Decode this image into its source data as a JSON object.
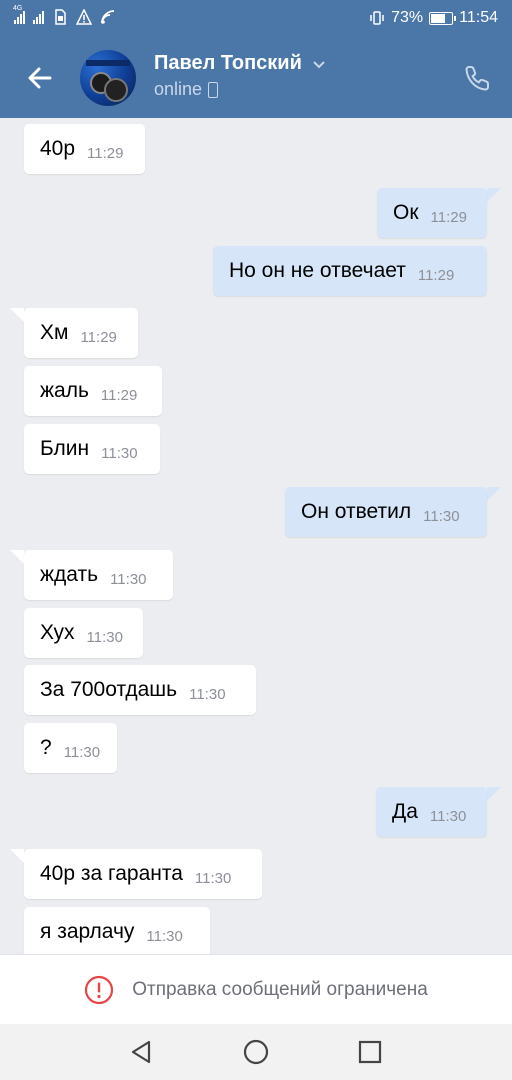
{
  "status_bar": {
    "network_left": "4G",
    "battery_percent": "73%",
    "battery_level": 0.73,
    "time": "11:54",
    "icons": [
      "signal-icon",
      "signal-icon",
      "sim-icon",
      "warning-icon",
      "wifi-icon",
      "vibrate-icon",
      "battery-icon"
    ]
  },
  "header": {
    "contact_name": "Павел Топский",
    "status": "online"
  },
  "messages": [
    {
      "text": "40р",
      "time": "11:29",
      "dir": "in"
    },
    {
      "text": "Ок",
      "time": "11:29",
      "dir": "out"
    },
    {
      "text": "Но он не отвечает",
      "time": "11:29",
      "dir": "out"
    },
    {
      "text": "Хм",
      "time": "11:29",
      "dir": "in"
    },
    {
      "text": "жаль",
      "time": "11:29",
      "dir": "in"
    },
    {
      "text": "Блин",
      "time": "11:30",
      "dir": "in"
    },
    {
      "text": "Он ответил",
      "time": "11:30",
      "dir": "out"
    },
    {
      "text": "ждать",
      "time": "11:30",
      "dir": "in"
    },
    {
      "text": "Хух",
      "time": "11:30",
      "dir": "in"
    },
    {
      "text": "За 700отдашь",
      "time": "11:30",
      "dir": "in"
    },
    {
      "text": "?",
      "time": "11:30",
      "dir": "in"
    },
    {
      "text": "Да",
      "time": "11:30",
      "dir": "out"
    },
    {
      "text": "40р за гаранта",
      "time": "11:30",
      "dir": "in"
    },
    {
      "text": "я зарлачу",
      "time": "11:30",
      "dir": "in"
    }
  ],
  "restriction": {
    "label": "Отправка сообщений ограничена"
  },
  "colors": {
    "header": "#4a76a8",
    "incoming_bubble": "#ffffff",
    "outgoing_bubble": "#d6e6f8",
    "chat_background": "#ebedf0",
    "warning": "#e64646"
  }
}
